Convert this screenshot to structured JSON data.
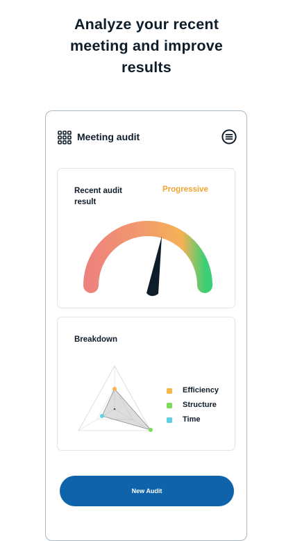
{
  "headline": {
    "line1": "Analyze your recent",
    "line2": "meeting and improve",
    "line3": "results"
  },
  "app": {
    "title": "Meeting audit",
    "grid_icon": "grid-icon",
    "menu_icon": "menu-icon"
  },
  "audit": {
    "label": "Recent audit result",
    "status": "Progressive",
    "status_color": "#f2a431",
    "gauge_value": 0.62,
    "gauge_colors": [
      "#ee837d",
      "#f5b255",
      "#3dcf75"
    ]
  },
  "breakdown": {
    "label": "Breakdown",
    "legend": [
      {
        "label": "Efficiency",
        "color": "#f5b64b"
      },
      {
        "label": "Structure",
        "color": "#7ddc57"
      },
      {
        "label": "Time",
        "color": "#5fd1e3"
      }
    ]
  },
  "cta": {
    "label": "New Audit",
    "color": "#0e63aa"
  }
}
